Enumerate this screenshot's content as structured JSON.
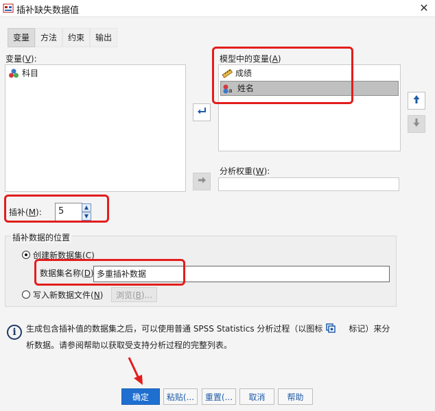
{
  "window": {
    "title": "插补缺失数据值",
    "close_glyph": "✕"
  },
  "tabs": [
    "变量",
    "方法",
    "约束",
    "输出"
  ],
  "variables": {
    "label_prefix": "变量(",
    "label_key": "V",
    "label_suffix": "):",
    "items": [
      "科目"
    ]
  },
  "model_variables": {
    "label_prefix": "模型中的变量(",
    "label_key": "A",
    "label_suffix": ")",
    "items": [
      {
        "name": "成绩",
        "icon": "scale-ruler-icon"
      },
      {
        "name": "姓名",
        "icon": "nominal-string-icon",
        "selected": true
      }
    ]
  },
  "analysis_weight": {
    "label_prefix": "分析权重(",
    "label_key": "W",
    "label_suffix": "):",
    "value": ""
  },
  "imputations": {
    "label_prefix": "插补(",
    "label_key": "M",
    "label_suffix": "):",
    "value": "5"
  },
  "location_group": {
    "title": "插补数据的位置",
    "create_new": {
      "label_prefix": "创建新数据集(",
      "label_key": "C",
      "label_suffix": ")",
      "checked": true
    },
    "dataset_name": {
      "label_prefix": "数据集名称(",
      "label_key": "D",
      "label_suffix": ")",
      "value": "多重插补数据"
    },
    "write_file": {
      "label_prefix": "写入新数据文件(",
      "label_key": "N",
      "label_suffix": ")",
      "checked": false
    },
    "browse": {
      "label_prefix": "浏览(",
      "label_key": "B",
      "label_suffix": ")..."
    }
  },
  "info": {
    "line1": "生成包含插补值的数据集之后，可以使用普通 SPSS Statistics 分析过程（以图标",
    "line1_after": "标记）来分",
    "line2": "析数据。请参阅帮助以获取受支持分析过程的完整列表。"
  },
  "buttons": {
    "ok": "确定",
    "paste": "粘贴(...",
    "reset": "重置(...",
    "cancel": "取消",
    "help": "帮助"
  },
  "colors": {
    "accent": "#1f6fd0",
    "highlight_red": "#e31c1c"
  }
}
